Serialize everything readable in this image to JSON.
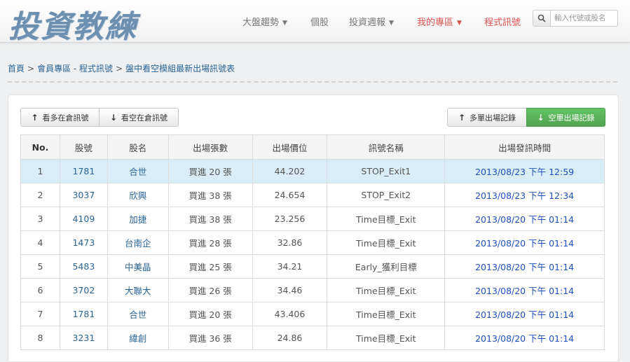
{
  "logo": "投資教練",
  "nav": [
    {
      "label": "大盤趨勢",
      "dropdown": true,
      "active": false
    },
    {
      "label": "個股",
      "dropdown": false,
      "active": false
    },
    {
      "label": "投資週報",
      "dropdown": true,
      "active": false
    },
    {
      "label": "我的專區",
      "dropdown": true,
      "active": true
    },
    {
      "label": "程式訊號",
      "dropdown": false,
      "active": true
    }
  ],
  "search": {
    "placeholder": "輸入代號或股名",
    "value": ""
  },
  "breadcrumb": [
    "首頁",
    "會員專區 - 程式訊號",
    "盤中看空模組最新出場訊號表"
  ],
  "buttons": {
    "long_position": "看多在倉訊號",
    "short_position": "看空在倉訊號",
    "long_exit": "多單出場記錄",
    "short_exit": "空單出場記錄"
  },
  "table": {
    "headers": [
      "No.",
      "股號",
      "股名",
      "出場張數",
      "出場價位",
      "訊號名稱",
      "出場發訊時間"
    ],
    "rows": [
      [
        "1",
        "1781",
        "合世",
        "買進 20 張",
        "44.202",
        "STOP_Exit1",
        "2013/08/23 下午 12:59"
      ],
      [
        "2",
        "3037",
        "欣興",
        "買進 38 張",
        "24.654",
        "STOP_Exit2",
        "2013/08/23 下午 12:34"
      ],
      [
        "3",
        "4109",
        "加捷",
        "買進 38 張",
        "23.256",
        "Time目標_Exit",
        "2013/08/20 下午 01:14"
      ],
      [
        "4",
        "1473",
        "台南企",
        "買進 28 張",
        "32.86",
        "Time目標_Exit",
        "2013/08/20 下午 01:14"
      ],
      [
        "5",
        "5483",
        "中美晶",
        "買進 25 張",
        "34.21",
        "Early_獲利目標",
        "2013/08/20 下午 01:14"
      ],
      [
        "6",
        "3702",
        "大聯大",
        "買進 26 張",
        "34.46",
        "Time目標_Exit",
        "2013/08/20 下午 01:14"
      ],
      [
        "7",
        "1781",
        "合世",
        "買進 20 張",
        "43.406",
        "Time目標_Exit",
        "2013/08/20 下午 01:14"
      ],
      [
        "8",
        "3231",
        "緯創",
        "買進 36 張",
        "24.86",
        "Time目標_Exit",
        "2013/08/20 下午 01:14"
      ]
    ]
  },
  "colors": {
    "accent_red": "#d9534f",
    "link_blue": "#2a6496",
    "time_blue": "#1f4fbf",
    "green": "#51a351",
    "highlight": "#d9edf7"
  }
}
